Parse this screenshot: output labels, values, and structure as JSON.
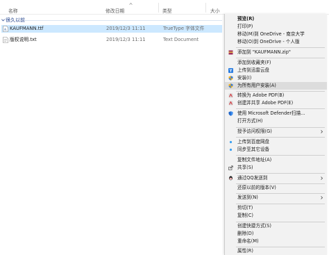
{
  "columns": {
    "name": "名称",
    "date": "修改日期",
    "type": "类型",
    "size": "大小"
  },
  "group": {
    "label": "很久以前"
  },
  "files": [
    {
      "name": "KAUFMANN.ttf",
      "date": "2019/12/3 11:11",
      "type": "TrueType 字体文件",
      "size": "",
      "selected": true,
      "icon": "font-file-icon"
    },
    {
      "name": "版权说明.txt",
      "date": "2019/12/3 11:11",
      "type": "Text Document",
      "size": "",
      "selected": false,
      "icon": "text-file-icon"
    }
  ],
  "context_menu": {
    "items": [
      {
        "label": "预览(R)",
        "bold": true
      },
      {
        "label": "打印(P)"
      },
      {
        "label": "移动(M)到 OneDrive - 南京大学"
      },
      {
        "label": "移动(O)到 OneDrive - 个人版"
      },
      {
        "label": "添加到 \"KAUFMANN.zip\"",
        "icon": "winrar-icon"
      },
      {
        "label": "添加到收藏夹(F)"
      },
      {
        "label": "上传到迅雷云盘",
        "icon": "thunder-cloud-icon"
      },
      {
        "label": "安装(I)",
        "icon": "shield-install-icon"
      },
      {
        "label": "为所有用户安装(A)",
        "icon": "shield-install-all-icon",
        "highlighted": true
      },
      {
        "label": "转换为 Adobe PDF(B)",
        "icon": "adobe-pdf-icon"
      },
      {
        "label": "创建并共享 Adobe PDF(E)",
        "icon": "adobe-share-pdf-icon"
      },
      {
        "label": "使用 Microsoft Defender扫描...",
        "icon": "defender-icon"
      },
      {
        "label": "打开方式(H)"
      },
      {
        "label": "授予访问权限(G)",
        "submenu": true
      },
      {
        "label": "上传到百度网盘",
        "icon": "baidu-netdisk-icon"
      },
      {
        "label": "同步至其它设备",
        "icon": "baidu-sync-icon"
      },
      {
        "label": "复制文件地址(A)"
      },
      {
        "label": "共享(S)",
        "icon": "share-icon"
      },
      {
        "label": "通过QQ发送到",
        "icon": "qq-icon",
        "submenu": true
      },
      {
        "label": "还原以前的版本(V)"
      },
      {
        "label": "发送到(N)",
        "submenu": true
      },
      {
        "label": "剪切(T)"
      },
      {
        "label": "复制(C)"
      },
      {
        "label": "创建快捷方式(S)"
      },
      {
        "label": "删除(D)"
      },
      {
        "label": "重命名(M)"
      },
      {
        "label": "属性(R)"
      }
    ]
  },
  "colors": {
    "selection": "#cce8ff",
    "menu_bg": "#f2f2f2",
    "menu_highlight": "#dcdcdc",
    "group_label": "#1e3f8a"
  }
}
